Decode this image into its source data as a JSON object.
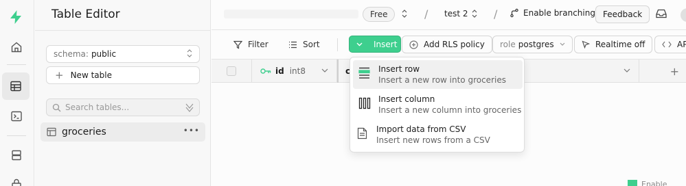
{
  "sidebar": {
    "title": "Table Editor",
    "schema": {
      "key": "schema:",
      "value": "public"
    },
    "new_table_label": "New table",
    "search_placeholder": "Search tables...",
    "tables": [
      {
        "name": "groceries"
      }
    ]
  },
  "topbar": {
    "plan_badge": "Free",
    "project": "test 2",
    "branching_label": "Enable branching",
    "feedback_label": "Feedback"
  },
  "toolbar": {
    "filter_label": "Filter",
    "sort_label": "Sort",
    "insert_label": "Insert",
    "rls_label": "Add RLS policy",
    "role": {
      "key": "role",
      "value": "postgres"
    },
    "realtime_label": "Realtime off",
    "api_label": "AP"
  },
  "grid": {
    "columns": [
      {
        "name": "id",
        "type": "int8"
      },
      {
        "name": "c",
        "type": ""
      }
    ]
  },
  "insert_menu": {
    "items": [
      {
        "title": "Insert row",
        "subtitle": "Insert a new row into groceries",
        "icon": "rows-icon"
      },
      {
        "title": "Insert column",
        "subtitle": "Insert a new column into groceries",
        "icon": "columns-icon"
      },
      {
        "title": "Import data from CSV",
        "subtitle": "Insert new rows from a CSV",
        "icon": "file-icon"
      }
    ]
  },
  "footer_hint": "Enable",
  "colors": {
    "brand": "#3ecf8e",
    "brand_border": "#34b27b",
    "key_icon": "#3ecf8e"
  }
}
